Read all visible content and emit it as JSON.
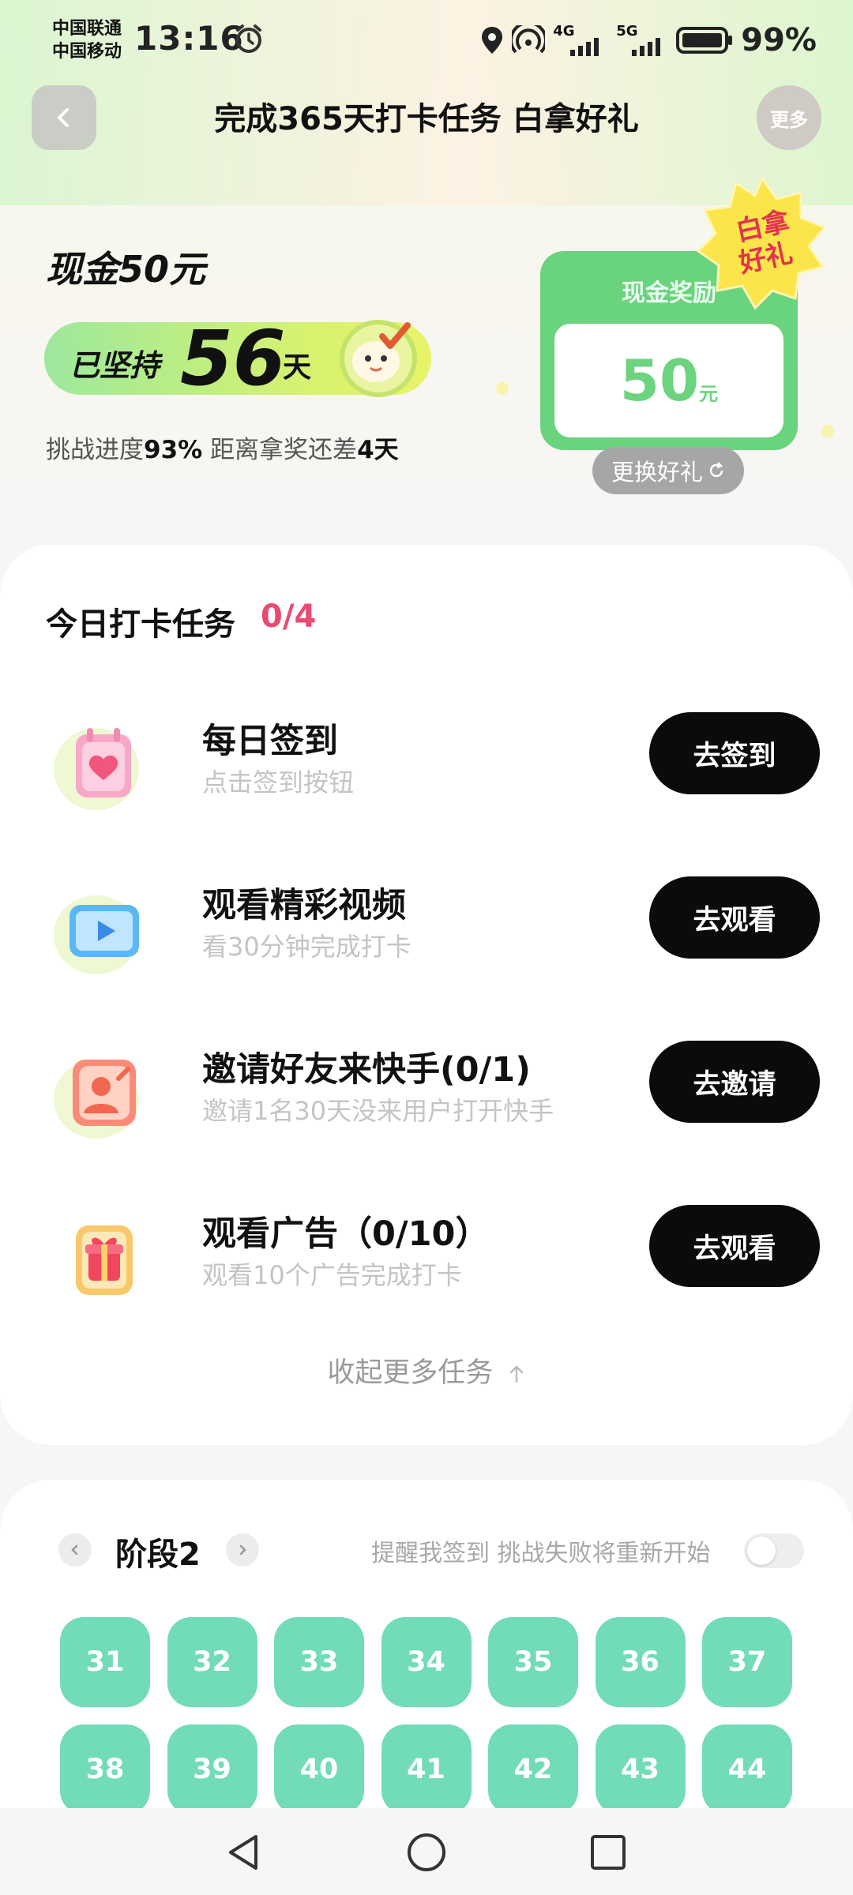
{
  "status_bar": {
    "carrier_1": "中国联通",
    "carrier_2": "中国移动",
    "time": "13:16",
    "network_4g": "4G",
    "network_5g": "5G",
    "battery": "99%"
  },
  "header": {
    "title": "完成365天打卡任务 白拿好礼",
    "more_label": "更多"
  },
  "hero": {
    "cash_title": "现金50元",
    "persist_label": "已坚持",
    "persist_days": "56",
    "persist_unit": "天",
    "progress_label": "挑战进度",
    "progress_value": "93%",
    "distance_label": "距离拿奖还差",
    "distance_value": "4天",
    "reward_card_title": "现金奖励",
    "reward_amount": "50",
    "reward_unit": "元",
    "badge_line1": "白拿",
    "badge_line2": "好礼",
    "change_gift_label": "更换好礼"
  },
  "tasks": {
    "heading": "今日打卡任务",
    "count": "0/4",
    "items": [
      {
        "title": "每日签到",
        "desc": "点击签到按钮",
        "button": "去签到"
      },
      {
        "title": "观看精彩视频",
        "desc": "看30分钟完成打卡",
        "button": "去观看"
      },
      {
        "title": "邀请好友来快手(0/1)",
        "desc": "邀请1名30天没来用户打开快手",
        "button": "去邀请"
      },
      {
        "title": "观看广告（0/10）",
        "desc": "观看10个广告完成打卡",
        "button": "去观看"
      }
    ],
    "collapse_label": "收起更多任务"
  },
  "stage": {
    "title": "阶段2",
    "remind_text": "提醒我签到 挑战失败将重新开始",
    "remind_enabled": false,
    "days": [
      "31",
      "32",
      "33",
      "34",
      "35",
      "36",
      "37",
      "38",
      "39",
      "40",
      "41",
      "42",
      "43",
      "44"
    ]
  },
  "colors": {
    "accent_green": "#72dcb6",
    "reward_green": "#6ad37d",
    "count_pink": "#ea4a72",
    "button_black": "#0b0b0b"
  }
}
